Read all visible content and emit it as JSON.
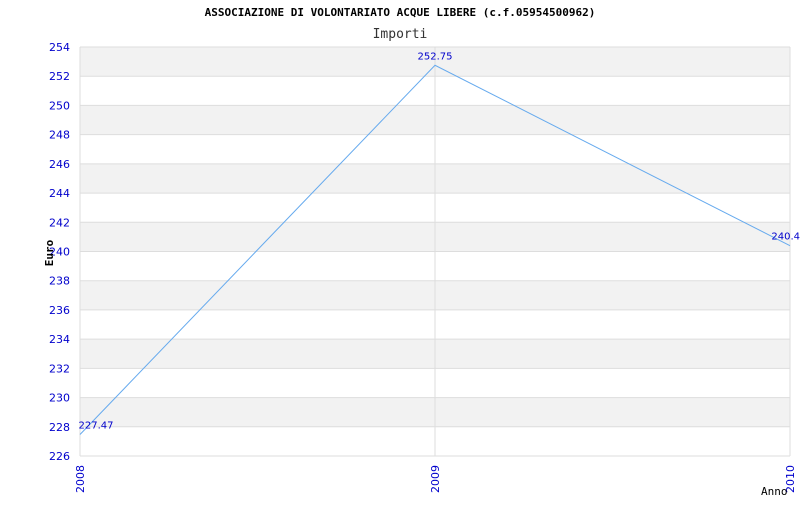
{
  "chart_data": {
    "type": "line",
    "title": "ASSOCIAZIONE DI VOLONTARIATO ACQUE LIBERE (c.f.05954500962)",
    "subtitle": "Importi",
    "xlabel": "Anno",
    "ylabel": "Euro",
    "x": [
      "2008",
      "2009",
      "2010"
    ],
    "series": [
      {
        "values": [
          227.47,
          252.75,
          240.4
        ],
        "labels": [
          "227.47",
          "252.75",
          "240.4"
        ]
      }
    ],
    "ylim": [
      226,
      254
    ],
    "yticks": [
      226,
      228,
      230,
      232,
      234,
      236,
      238,
      240,
      242,
      244,
      246,
      248,
      250,
      252,
      254
    ],
    "grid": true,
    "colors": {
      "line": "#66aaee",
      "tick_text": "#0000cc",
      "band": "#f2f2f2",
      "grid": "#dddddd",
      "title": "#000000",
      "subtitle": "#333333"
    }
  }
}
